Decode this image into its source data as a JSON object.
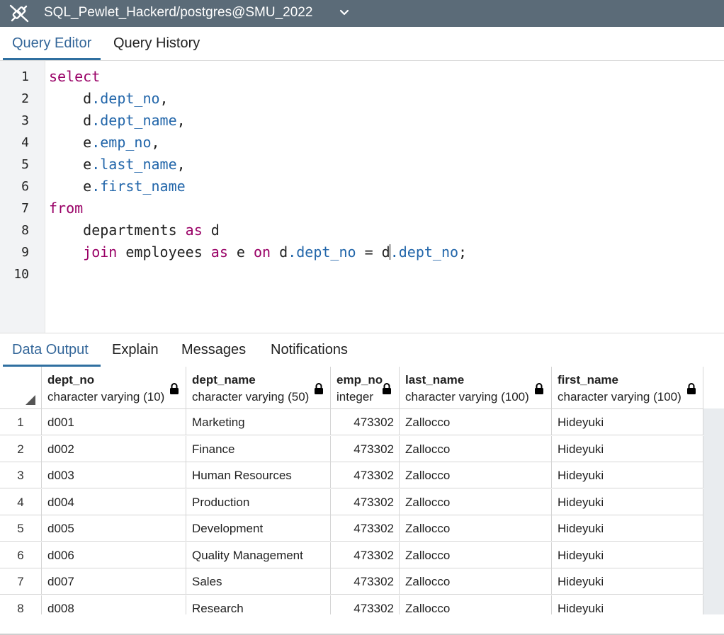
{
  "connection": {
    "title": "SQL_Pewlet_Hackerd/postgres@SMU_2022",
    "icon": "plug-disconnected-icon"
  },
  "top_tabs": [
    {
      "label": "Query Editor",
      "active": true
    },
    {
      "label": "Query History",
      "active": false
    }
  ],
  "editor": {
    "line_numbers": [
      "1",
      "2",
      "3",
      "4",
      "5",
      "6",
      "7",
      "8",
      "9",
      "10"
    ]
  },
  "bottom_tabs": [
    {
      "label": "Data Output",
      "active": true
    },
    {
      "label": "Explain",
      "active": false
    },
    {
      "label": "Messages",
      "active": false
    },
    {
      "label": "Notifications",
      "active": false
    }
  ],
  "grid": {
    "columns": [
      {
        "name": "dept_no",
        "type": "character varying (10)"
      },
      {
        "name": "dept_name",
        "type": "character varying (50)"
      },
      {
        "name": "emp_no",
        "type": "integer"
      },
      {
        "name": "last_name",
        "type": "character varying (100)"
      },
      {
        "name": "first_name",
        "type": "character varying (100)"
      }
    ],
    "rows": [
      [
        "1",
        "d001",
        "Marketing",
        "473302",
        "Zallocco",
        "Hideyuki"
      ],
      [
        "2",
        "d002",
        "Finance",
        "473302",
        "Zallocco",
        "Hideyuki"
      ],
      [
        "3",
        "d003",
        "Human Resources",
        "473302",
        "Zallocco",
        "Hideyuki"
      ],
      [
        "4",
        "d004",
        "Production",
        "473302",
        "Zallocco",
        "Hideyuki"
      ],
      [
        "5",
        "d005",
        "Development",
        "473302",
        "Zallocco",
        "Hideyuki"
      ],
      [
        "6",
        "d006",
        "Quality Management",
        "473302",
        "Zallocco",
        "Hideyuki"
      ],
      [
        "7",
        "d007",
        "Sales",
        "473302",
        "Zallocco",
        "Hideyuki"
      ],
      [
        "8",
        "d008",
        "Research",
        "473302",
        "Zallocco",
        "Hideyuki"
      ]
    ]
  },
  "colors": {
    "titlebar": "#5b6b78",
    "keyword": "#990066",
    "field": "#2266aa",
    "active_tab": "#336699"
  }
}
